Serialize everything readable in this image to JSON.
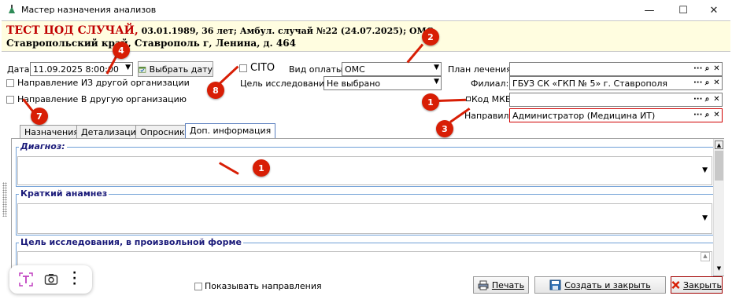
{
  "window": {
    "title": "Мастер назначения анализов",
    "minimize": "—",
    "maximize": "☐",
    "close": "✕"
  },
  "patient": {
    "name": "ТЕСТ ЦОД СЛУЧАЙ,",
    "details": " 03.01.1989, 36 лет; Амбул. случай №22 (24.07.2025); ОМС",
    "address": "Ставропольский край, Ставрополь г, Ленина, д. 464"
  },
  "form": {
    "date_label": "Дата:",
    "date_value": "11.09.2025 8:00:00",
    "pick_date_button": "Выбрать дату",
    "cito_label": "CITO",
    "payment_label": "Вид оплаты:",
    "payment_value": "ОМС",
    "purpose_label": "Цель исследования:",
    "purpose_value": "Не выбрано",
    "from_other_org": "Направление ИЗ другой организации",
    "to_other_org": "Направление В другую организацию",
    "plan_label": "План лечения:",
    "plan_value": "",
    "branch_label": "Филиал:",
    "branch_value": "ГБУЗ СК «ГКП № 5» г. Ставрополя",
    "mkb_label": "Код МКБ:",
    "mkb_value": "",
    "referrer_label": "Направил:",
    "referrer_value": "Администратор (Медицина ИТ)",
    "lookup_dots": "···",
    "lookup_search": "🔍",
    "lookup_clear": "✕"
  },
  "tabs": [
    "Назначения",
    "Детализация",
    "Опросник",
    "Доп. информация"
  ],
  "panel": {
    "diagnosis_title": "Диагноз:",
    "anamnesis_title": "Краткий анамнез",
    "purpose_free_title": "Цель исследования, в произвольной форме"
  },
  "markers": [
    "4",
    "2",
    "8",
    "1",
    "3",
    "7",
    "1"
  ],
  "footer": {
    "show_referrals": "Показывать направления",
    "print": "Печать",
    "create_close": "Создать и закрыть",
    "close": "Закрыть"
  },
  "colors": {
    "marker": "#d81e05",
    "header_bg": "#fffde0",
    "patient_name": "#c00000"
  }
}
